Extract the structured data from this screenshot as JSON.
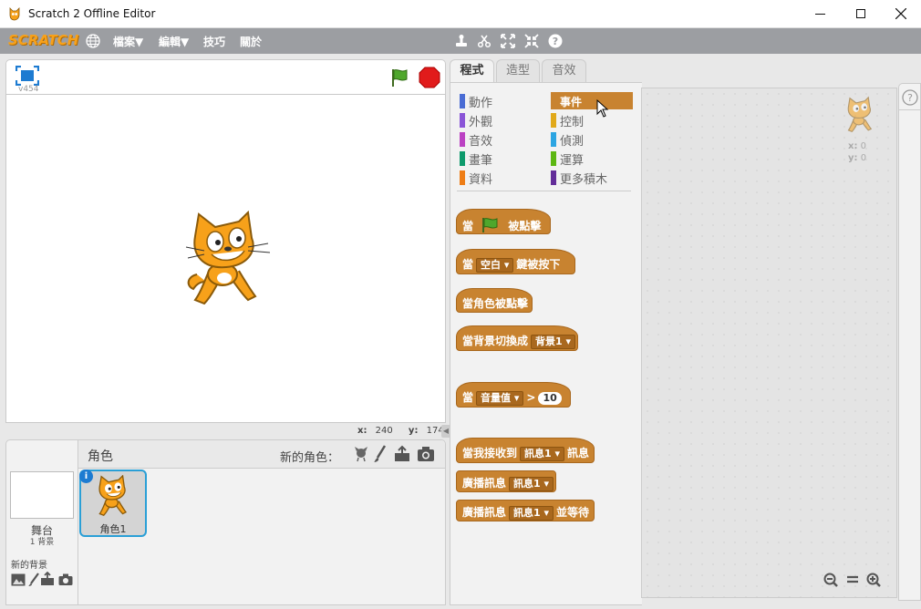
{
  "window": {
    "title": "Scratch 2 Offline Editor"
  },
  "menu": {
    "logo": "SCRATCH",
    "items": [
      "檔案",
      "編輯",
      "技巧",
      "關於"
    ],
    "has_dropdown": [
      true,
      true,
      false,
      false
    ]
  },
  "stage": {
    "version": "v454",
    "mouse_x_label": "x:",
    "mouse_x": "240",
    "mouse_y_label": "y:",
    "mouse_y": "174"
  },
  "sprites_panel": {
    "title": "角色",
    "new_sprite_label": "新的角色：",
    "stage_label": "舞台",
    "stage_backdrops": "1 背景",
    "new_backdrop_label": "新的背景",
    "sprites": [
      {
        "name": "角色1"
      }
    ]
  },
  "tabs": [
    "程式",
    "造型",
    "音效"
  ],
  "active_tab": 0,
  "categories": [
    {
      "label": "動作",
      "color": "#4a6cd4"
    },
    {
      "label": "事件",
      "color": "#c88330",
      "selected": true
    },
    {
      "label": "外觀",
      "color": "#8a55d7"
    },
    {
      "label": "控制",
      "color": "#e1a91a"
    },
    {
      "label": "音效",
      "color": "#bb42c3"
    },
    {
      "label": "偵測",
      "color": "#2ca5e2"
    },
    {
      "label": "畫筆",
      "color": "#0e9a6c"
    },
    {
      "label": "運算",
      "color": "#5cb712"
    },
    {
      "label": "資料",
      "color": "#ee7d16"
    },
    {
      "label": "更多積木",
      "color": "#632d99"
    }
  ],
  "blocks": {
    "b1": {
      "pre": "當",
      "post": "被點擊"
    },
    "b2": {
      "pre": "當",
      "dd": "空白",
      "post": "鍵被按下"
    },
    "b3": {
      "pre": "當角色被點擊"
    },
    "b4": {
      "pre": "當背景切換成",
      "dd": "背景1"
    },
    "b5": {
      "pre": "當",
      "dd": "音量值",
      "op": ">",
      "num": "10"
    },
    "b6": {
      "pre": "當我接收到",
      "dd": "訊息1",
      "post": "訊息"
    },
    "b7": {
      "pre": "廣播訊息",
      "dd": "訊息1"
    },
    "b8": {
      "pre": "廣播訊息",
      "dd": "訊息1",
      "post": "並等待"
    }
  },
  "script_area": {
    "sprite_x_label": "x:",
    "sprite_x": "0",
    "sprite_y_label": "y:",
    "sprite_y": "0"
  },
  "colors": {
    "menubar": "#9c9ea2",
    "events": "#c88330",
    "selection": "#2a9fd6"
  }
}
